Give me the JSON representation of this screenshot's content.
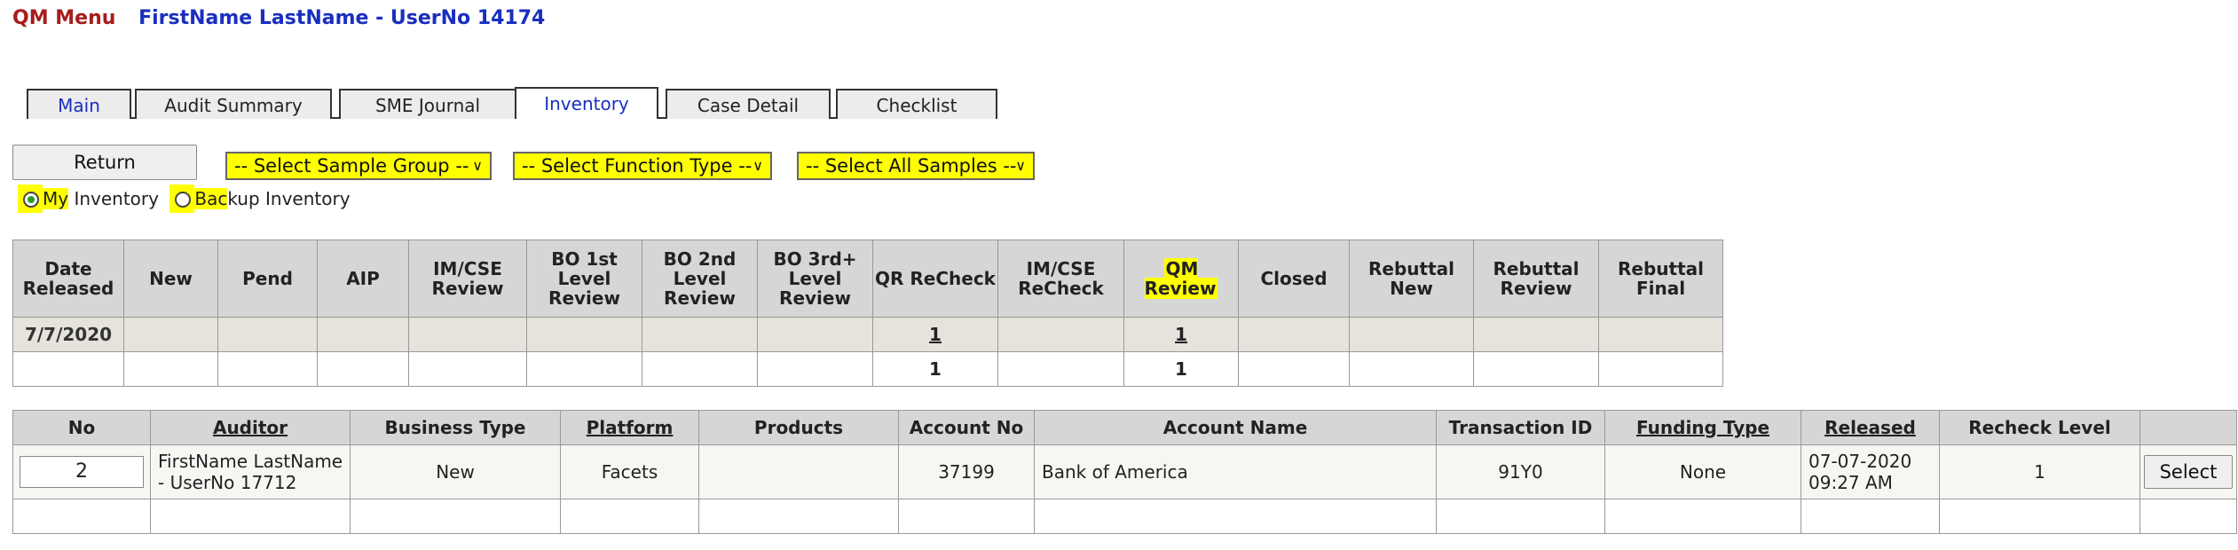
{
  "header": {
    "menu_label": "QM Menu",
    "user_label": "FirstName LastName - UserNo 14174"
  },
  "tabs": [
    {
      "label": "Main"
    },
    {
      "label": "Audit Summary"
    },
    {
      "label": "SME Journal"
    },
    {
      "label": "Inventory"
    },
    {
      "label": "Case Detail"
    },
    {
      "label": "Checklist"
    }
  ],
  "controls": {
    "return_label": "Return",
    "sample_group": "-- Select Sample Group --",
    "function_type": "-- Select Function Type --",
    "all_samples": "-- Select All Samples --",
    "radio_my_part1": "My",
    "radio_my_part2": " Inventory",
    "radio_backup_part1": "Bac",
    "radio_backup_part2": "kup Inventory"
  },
  "inventory": {
    "headers": [
      "Date Released",
      "New",
      "Pend",
      "AIP",
      "IM/CSE Review",
      "BO 1st Level Review",
      "BO 2nd Level Review",
      "BO 3rd+ Level Review",
      "QR ReCheck",
      "IM/CSE ReCheck",
      "QM Review",
      "Closed",
      "Rebuttal New",
      "Rebuttal Review",
      "Rebuttal Final"
    ],
    "row_date": "7/7/2020",
    "row_qr_recheck": "1",
    "row_qm_review": "1",
    "total_qr_recheck": "1",
    "total_qm_review": "1"
  },
  "samples": {
    "headers": [
      "No",
      "Auditor",
      "Business Type",
      "Platform",
      "Products",
      "Account No",
      "Account Name",
      "Transaction ID",
      "Funding Type",
      "Released",
      "Recheck Level",
      ""
    ],
    "row": {
      "no": "2",
      "auditor_line1": "FirstName LastName",
      "auditor_line2": "- UserNo 17712",
      "business_type": "New",
      "platform": "Facets",
      "products": "",
      "account_no": "37199",
      "account_name": "Bank of America",
      "transaction_id": "91Y0",
      "funding_type": "None",
      "released_line1": "07-07-2020",
      "released_line2": "09:27 AM",
      "recheck_level": "1",
      "select_label": "Select"
    }
  },
  "colors": {
    "highlight": "#ffff00",
    "menu_red": "#a61c1c",
    "link_blue": "#1a2fbf"
  }
}
